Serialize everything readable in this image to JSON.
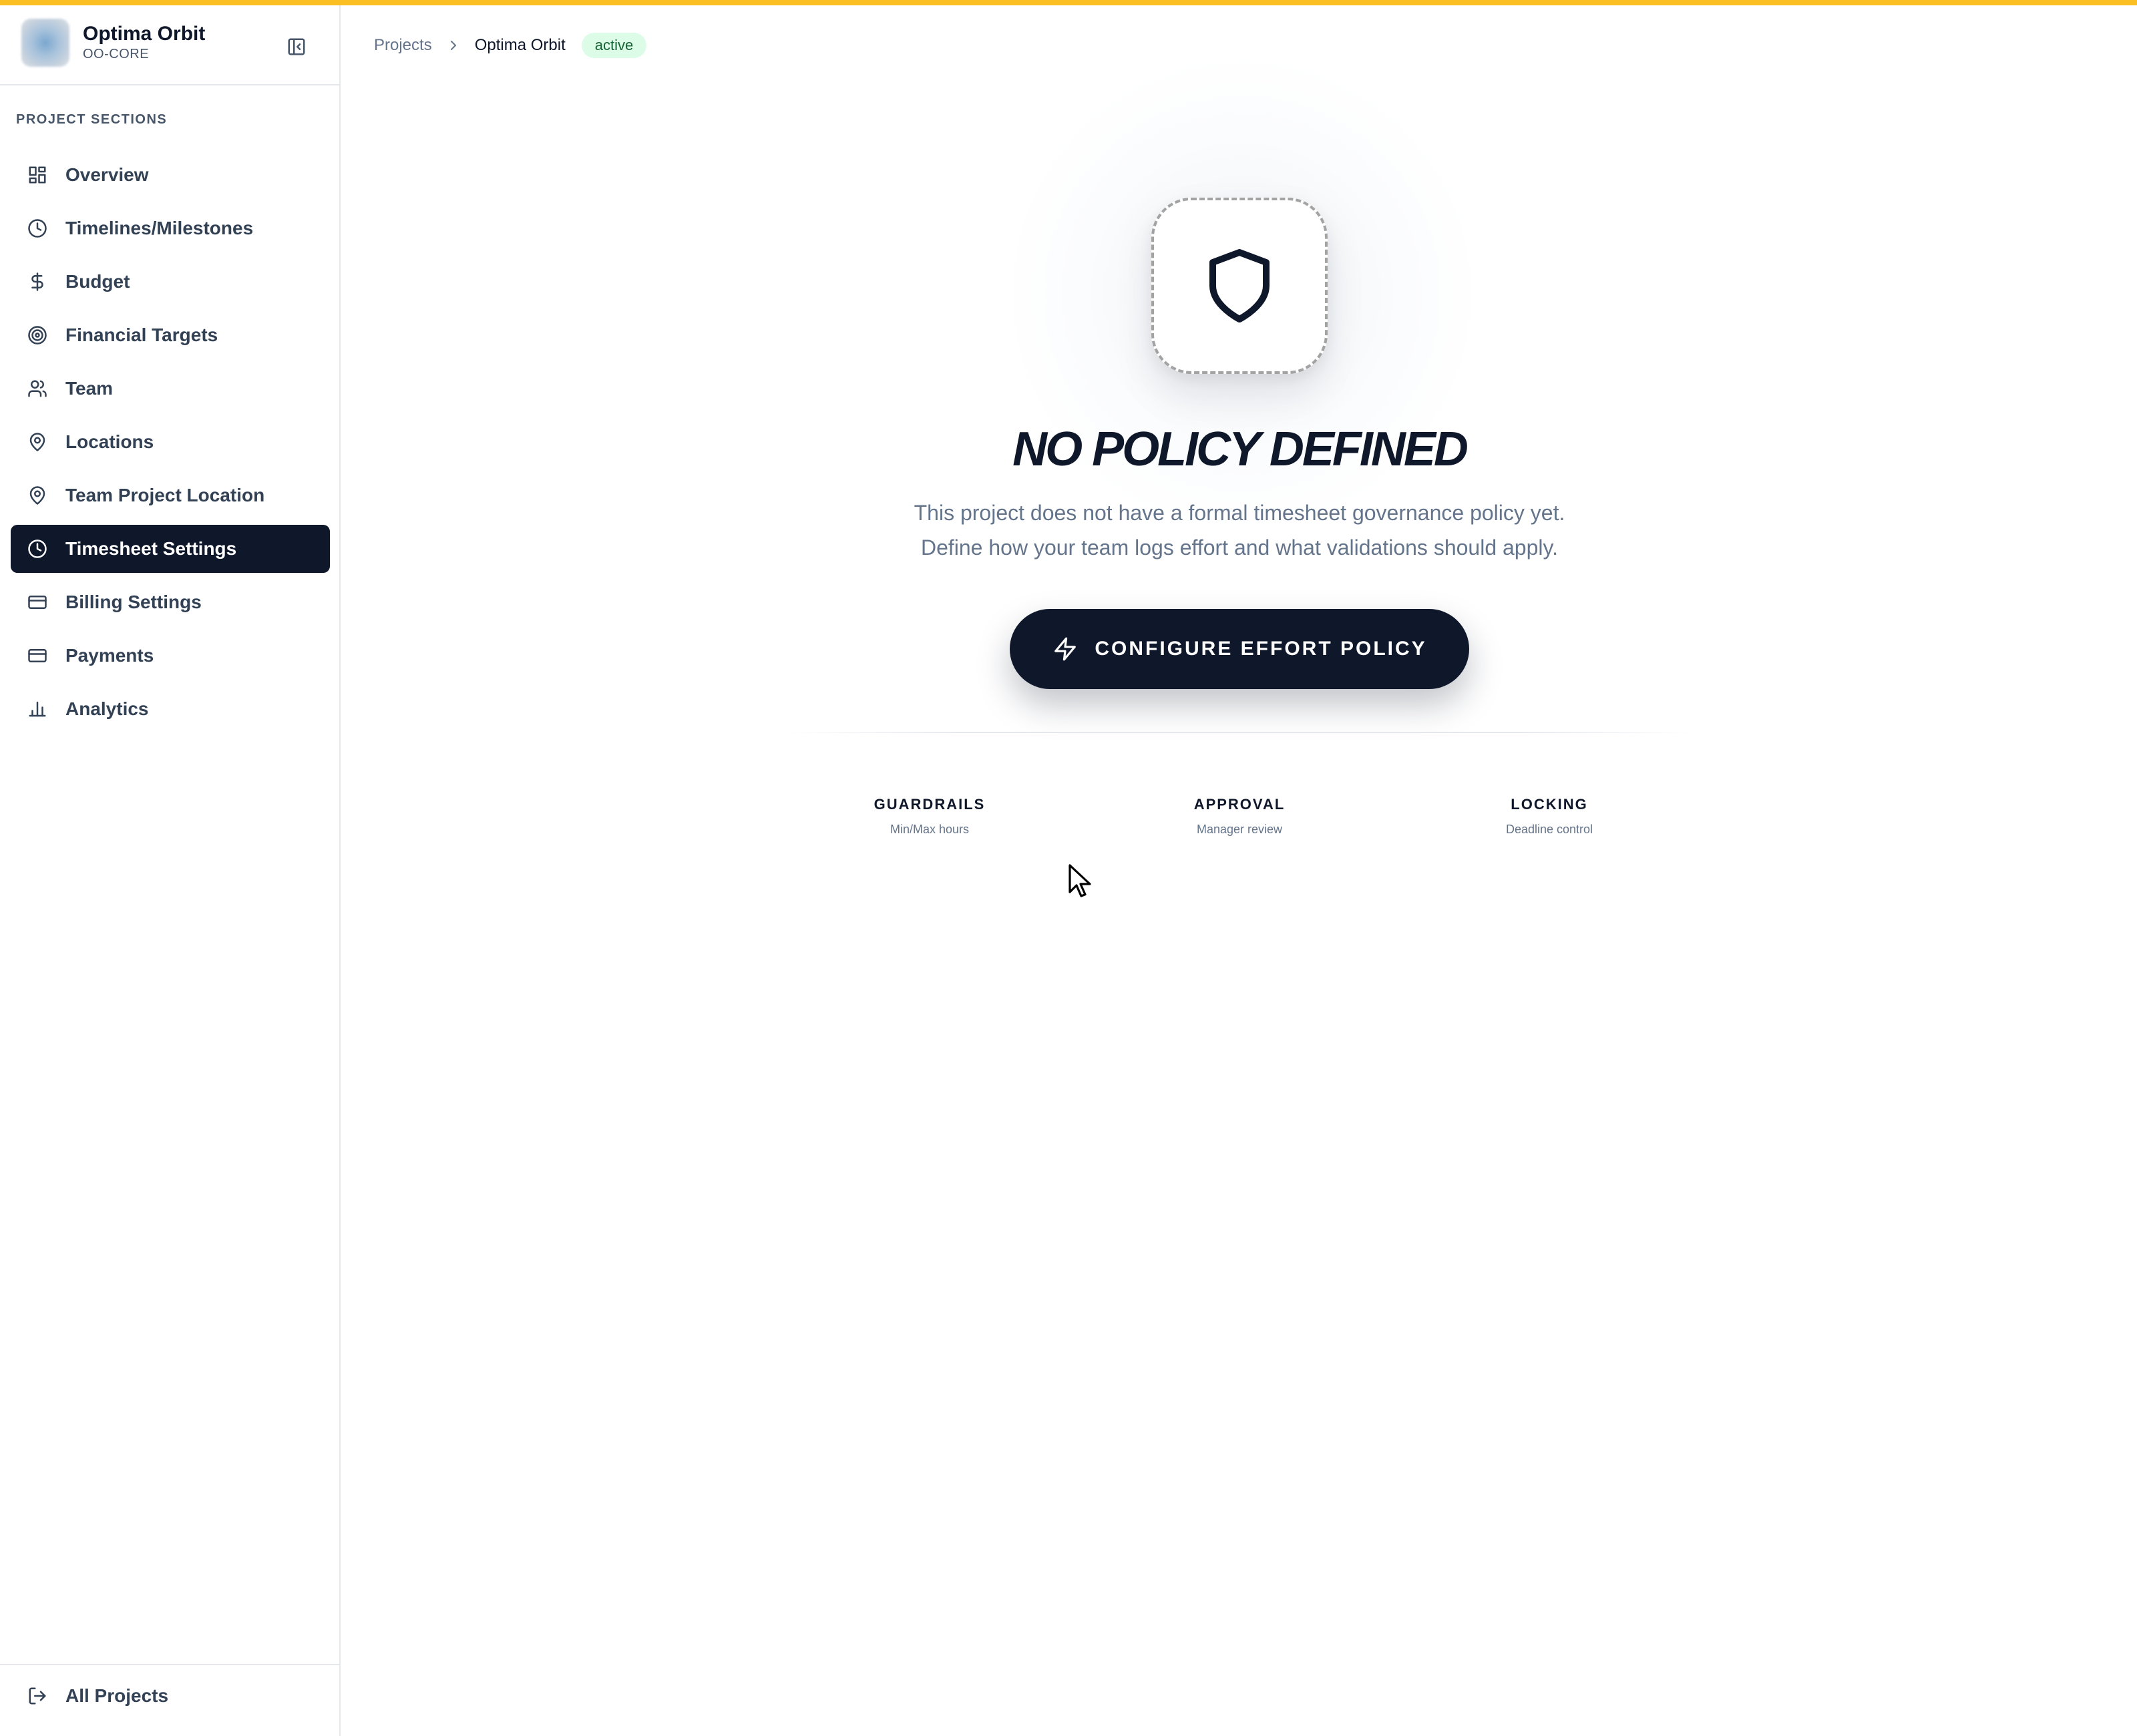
{
  "brand": {
    "name": "Optima Orbit",
    "code": "OO-CORE"
  },
  "sidebar": {
    "section_title": "PROJECT SECTIONS",
    "items": [
      {
        "label": "Overview",
        "icon": "layout-grid-icon"
      },
      {
        "label": "Timelines/Milestones",
        "icon": "clock-icon"
      },
      {
        "label": "Budget",
        "icon": "dollar-icon"
      },
      {
        "label": "Financial Targets",
        "icon": "target-icon"
      },
      {
        "label": "Team",
        "icon": "users-icon"
      },
      {
        "label": "Locations",
        "icon": "map-pin-icon"
      },
      {
        "label": "Team Project Location",
        "icon": "map-pin-icon"
      },
      {
        "label": "Timesheet Settings",
        "icon": "clock-icon",
        "active": true
      },
      {
        "label": "Billing Settings",
        "icon": "credit-card-icon"
      },
      {
        "label": "Payments",
        "icon": "credit-card-icon"
      },
      {
        "label": "Analytics",
        "icon": "bar-chart-icon"
      }
    ],
    "footer": {
      "label": "All Projects",
      "icon": "log-out-icon"
    }
  },
  "breadcrumb": {
    "root": "Projects",
    "current": "Optima Orbit",
    "status": "active"
  },
  "empty_state": {
    "icon": "shield-icon",
    "title": "NO POLICY DEFINED",
    "line1": "This project does not have a formal timesheet governance policy yet.",
    "line2": "Define how your team logs effort and what validations should apply.",
    "cta_label": "CONFIGURE EFFORT POLICY",
    "cta_icon": "zap-icon"
  },
  "features": [
    {
      "title": "GUARDRAILS",
      "subtitle": "Min/Max hours"
    },
    {
      "title": "APPROVAL",
      "subtitle": "Manager review"
    },
    {
      "title": "LOCKING",
      "subtitle": "Deadline control"
    }
  ],
  "colors": {
    "accent_bar": "#fbbf24",
    "active_nav": "#0f172a",
    "badge_bg": "#dcfce7",
    "badge_text": "#166534"
  }
}
